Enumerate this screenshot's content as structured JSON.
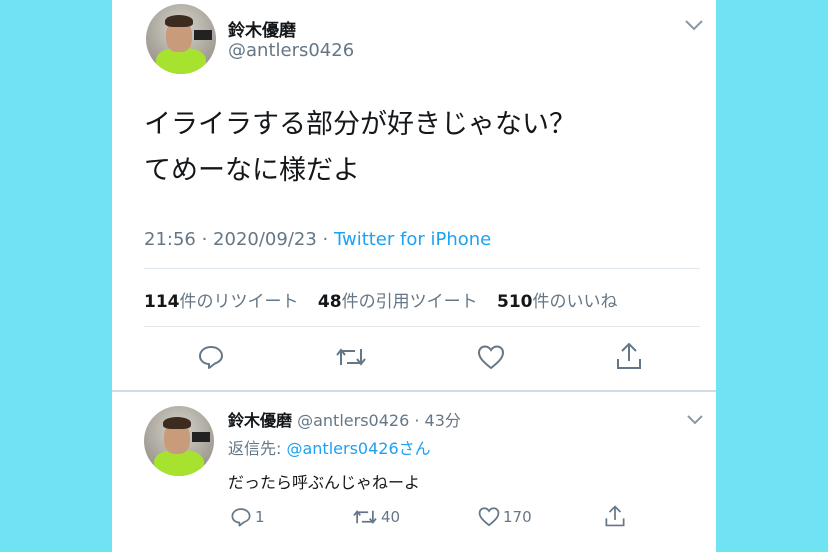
{
  "tweet": {
    "name": "鈴木優磨",
    "handle": "@antlers0426",
    "text_line1": "イライラする部分が好きじゃない？",
    "text_line2": "てめーなに様だよ",
    "time": "21:56 · 2020/09/23 · ",
    "source": "Twitter for iPhone",
    "stats": {
      "retweets_count": "114",
      "retweets_label": "件のリツイート",
      "quotes_count": "48",
      "quotes_label": "件の引用ツイート",
      "likes_count": "510",
      "likes_label": "件のいいね"
    }
  },
  "reply": {
    "name": "鈴木優磨",
    "handle_time": "@antlers0426 · 43分",
    "replying_prefix": "返信先: ",
    "replying_to": "@antlers0426さん",
    "text": "だったら呼ぶんじゃねーよ",
    "reply_count": "1",
    "retweet_count": "40",
    "like_count": "170"
  },
  "colors": {
    "background": "#6fe3f3",
    "link": "#1da1f2",
    "muted": "#657786",
    "jersey": "#a6e22e"
  },
  "icons": [
    "chevron-down-icon",
    "reply-icon",
    "retweet-icon",
    "like-icon",
    "share-icon"
  ]
}
